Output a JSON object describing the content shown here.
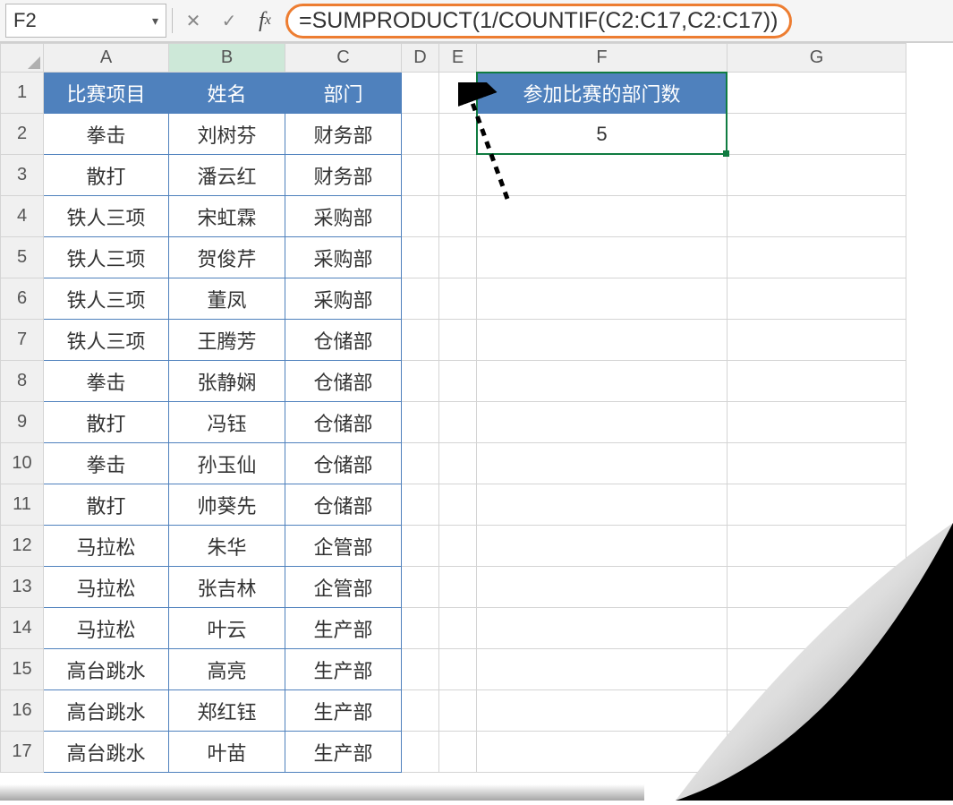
{
  "name_box": "F2",
  "formula": "=SUMPRODUCT(1/COUNTIF(C2:C17,C2:C17))",
  "columns": [
    "A",
    "B",
    "C",
    "D",
    "E",
    "F",
    "G"
  ],
  "row_count": 17,
  "headers": {
    "A": "比赛项目",
    "B": "姓名",
    "C": "部门",
    "F": "参加比赛的部门数"
  },
  "result_value": "5",
  "data_rows": [
    {
      "a": "拳击",
      "b": "刘树芬",
      "c": "财务部"
    },
    {
      "a": "散打",
      "b": "潘云红",
      "c": "财务部"
    },
    {
      "a": "铁人三项",
      "b": "宋虹霖",
      "c": "采购部"
    },
    {
      "a": "铁人三项",
      "b": "贺俊芹",
      "c": "采购部"
    },
    {
      "a": "铁人三项",
      "b": "董凤",
      "c": "采购部"
    },
    {
      "a": "铁人三项",
      "b": "王腾芳",
      "c": "仓储部"
    },
    {
      "a": "拳击",
      "b": "张静娴",
      "c": "仓储部"
    },
    {
      "a": "散打",
      "b": "冯钰",
      "c": "仓储部"
    },
    {
      "a": "拳击",
      "b": "孙玉仙",
      "c": "仓储部"
    },
    {
      "a": "散打",
      "b": "帅葵先",
      "c": "仓储部"
    },
    {
      "a": "马拉松",
      "b": "朱华",
      "c": "企管部"
    },
    {
      "a": "马拉松",
      "b": "张吉林",
      "c": "企管部"
    },
    {
      "a": "马拉松",
      "b": "叶云",
      "c": "生产部"
    },
    {
      "a": "高台跳水",
      "b": "高亮",
      "c": "生产部"
    },
    {
      "a": "高台跳水",
      "b": "郑红钰",
      "c": "生产部"
    },
    {
      "a": "高台跳水",
      "b": "叶苗",
      "c": "生产部"
    }
  ],
  "colors": {
    "header_fill": "#4f81bd",
    "highlight_border": "#ed7d31",
    "active_border": "#107c41"
  }
}
